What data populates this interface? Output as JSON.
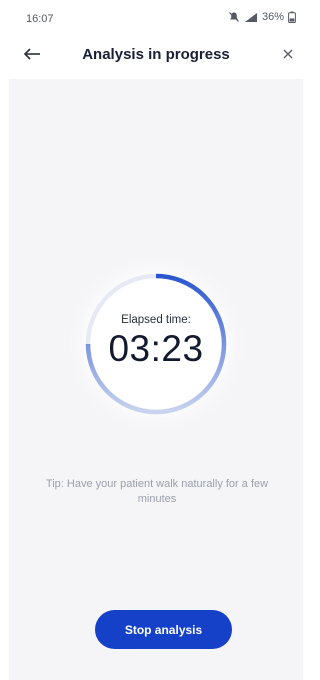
{
  "status_bar": {
    "time": "16:07",
    "battery": "36%",
    "icons": [
      "mute-icon",
      "signal-icon",
      "battery-icon"
    ]
  },
  "header": {
    "title": "Analysis in progress",
    "back_icon": "arrow-left-icon",
    "close_icon": "close-icon"
  },
  "timer": {
    "label": "Elapsed time:",
    "value": "03:23",
    "progress_fraction": 0.75,
    "colors": {
      "arc_start": "#e6e9f4",
      "arc_end": "#2b55cf"
    }
  },
  "tip": "Tip: Have your patient walk naturally for a few minutes",
  "actions": {
    "stop_label": "Stop analysis"
  },
  "colors": {
    "primary": "#1540c8",
    "background": "#f5f5f8",
    "tip_text": "#9aa0ad"
  }
}
